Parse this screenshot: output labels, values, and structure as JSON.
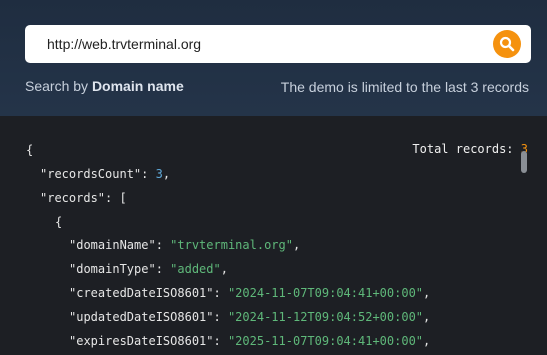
{
  "search": {
    "value": "http://web.trvterminal.org",
    "placeholder": "",
    "by_prefix": "Search by",
    "by_field": "Domain name",
    "demo_note": "The demo is limited to the last 3 records",
    "button_icon": "search-icon",
    "button_color": "#f5920f"
  },
  "result": {
    "total_label": "Total records: ",
    "total_value": "3",
    "lines": {
      "l1": "{",
      "l2_key": "\"recordsCount\"",
      "l2_colon": ": ",
      "l2_value": "3",
      "l2_end": ",",
      "l3_key": "\"records\"",
      "l3_rest": ": [",
      "l4": "{",
      "l5_key": "\"domainName\"",
      "l5_colon": ": ",
      "l5_value": "\"trvterminal.org\"",
      "l5_end": ",",
      "l6_key": "\"domainType\"",
      "l6_colon": ": ",
      "l6_value": "\"added\"",
      "l6_end": ",",
      "l7_key": "\"createdDateISO8601\"",
      "l7_colon": ": ",
      "l7_value": "\"2024-11-07T09:04:41+00:00\"",
      "l7_end": ",",
      "l8_key": "\"updatedDateISO8601\"",
      "l8_colon": ": ",
      "l8_value": "\"2024-11-12T09:04:52+00:00\"",
      "l8_end": ",",
      "l9_key": "\"expiresDateISO8601\"",
      "l9_colon": ": ",
      "l9_value": "\"2025-11-07T09:04:41+00:00\"",
      "l9_end": ","
    }
  }
}
